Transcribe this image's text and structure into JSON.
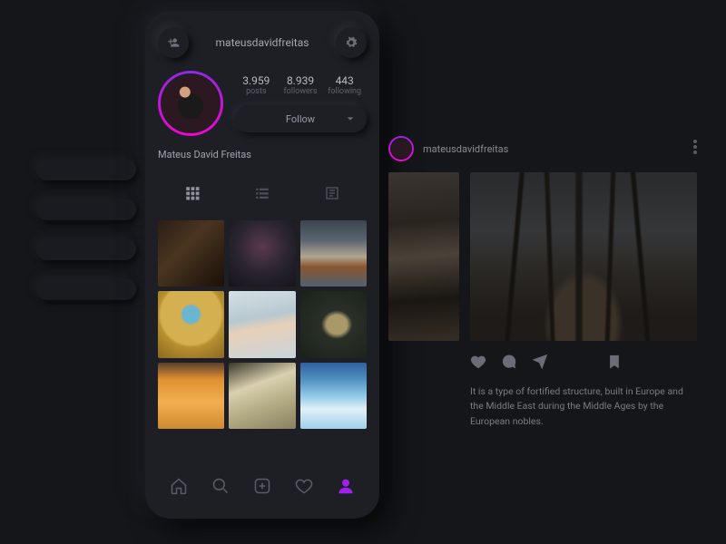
{
  "profile": {
    "username": "mateusdavidfreitas",
    "display_name": "Mateus David Freitas",
    "stats": {
      "posts": {
        "value": "3.959",
        "label": "posts"
      },
      "followers": {
        "value": "8.939",
        "label": "followers"
      },
      "following": {
        "value": "443",
        "label": "following"
      }
    },
    "follow_label": "Follow"
  },
  "post": {
    "username": "mateusdavidfreitas",
    "caption": "It is a type of fortified structure, built in Europe and the Middle East during the Middle Ages by the European nobles."
  }
}
